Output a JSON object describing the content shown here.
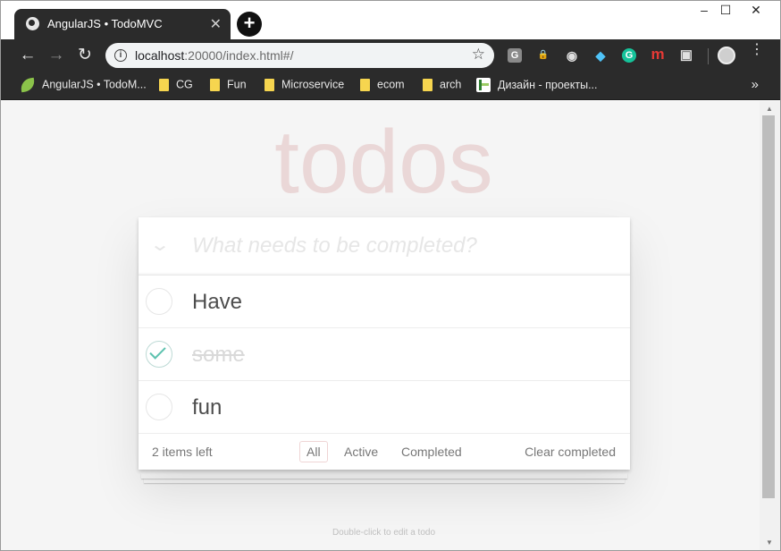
{
  "browser": {
    "tab": {
      "title": "AngularJS • TodoMVC",
      "close_glyph": "✕",
      "favicon": "globe-icon"
    },
    "new_tab_glyph": "+",
    "window_controls": {
      "minimize": "–",
      "maximize": "☐",
      "close": "✕"
    },
    "toolbar": {
      "back_glyph": "←",
      "forward_glyph": "→",
      "reload_glyph": "↻",
      "url_host": "localhost",
      "url_rest": ":20000/index.html#/",
      "info_glyph": "i",
      "star_glyph": "☆",
      "menu_glyph": "⋮"
    },
    "extensions": [
      {
        "icon": "g-square-icon",
        "glyph": "G",
        "color": "#8a8a8a"
      },
      {
        "icon": "lock-icon",
        "glyph": "🔒",
        "color": "#2b2b2b"
      },
      {
        "icon": "circle-icon",
        "glyph": "◉",
        "color": "#2b2b2b"
      },
      {
        "icon": "diamond-icon",
        "glyph": "◆",
        "color": "#2b2b2b"
      },
      {
        "icon": "grammarly-icon",
        "glyph": "G",
        "color": "#15c39a"
      },
      {
        "icon": "m-icon",
        "glyph": "m",
        "color": "#2b2b2b"
      },
      {
        "icon": "screenshot-icon",
        "glyph": "▣",
        "color": "#2b2b2b"
      }
    ],
    "bookmarks": [
      {
        "label": "AngularJS • TodoM...",
        "icon": "leaf-icon"
      },
      {
        "label": "CG",
        "icon": "folder-icon"
      },
      {
        "label": "Fun",
        "icon": "folder-icon"
      },
      {
        "label": "Microservice",
        "icon": "folder-icon"
      },
      {
        "label": "ecom",
        "icon": "folder-icon"
      },
      {
        "label": "arch",
        "icon": "folder-icon"
      },
      {
        "label": "Дизайн - проекты...",
        "icon": "design-icon"
      }
    ],
    "bookmarks_more_glyph": "»",
    "scroll_up_glyph": "▲",
    "scroll_down_glyph": "▼"
  },
  "app": {
    "title": "todos",
    "new_todo_placeholder": "What needs to be completed?",
    "toggle_all_glyph": "⌄",
    "todos": [
      {
        "title": "Have",
        "completed": false
      },
      {
        "title": "some",
        "completed": true
      },
      {
        "title": "fun",
        "completed": false
      }
    ],
    "footer": {
      "count": "2 items left",
      "filters": [
        "All",
        "Active",
        "Completed"
      ],
      "selected_filter": "All",
      "clear_completed": "Clear completed"
    },
    "info": "Double-click to edit a todo"
  },
  "colors": {
    "title": "#af2f2f",
    "check": "#5dc2af",
    "chrome_dark": "#2b2b2b"
  }
}
